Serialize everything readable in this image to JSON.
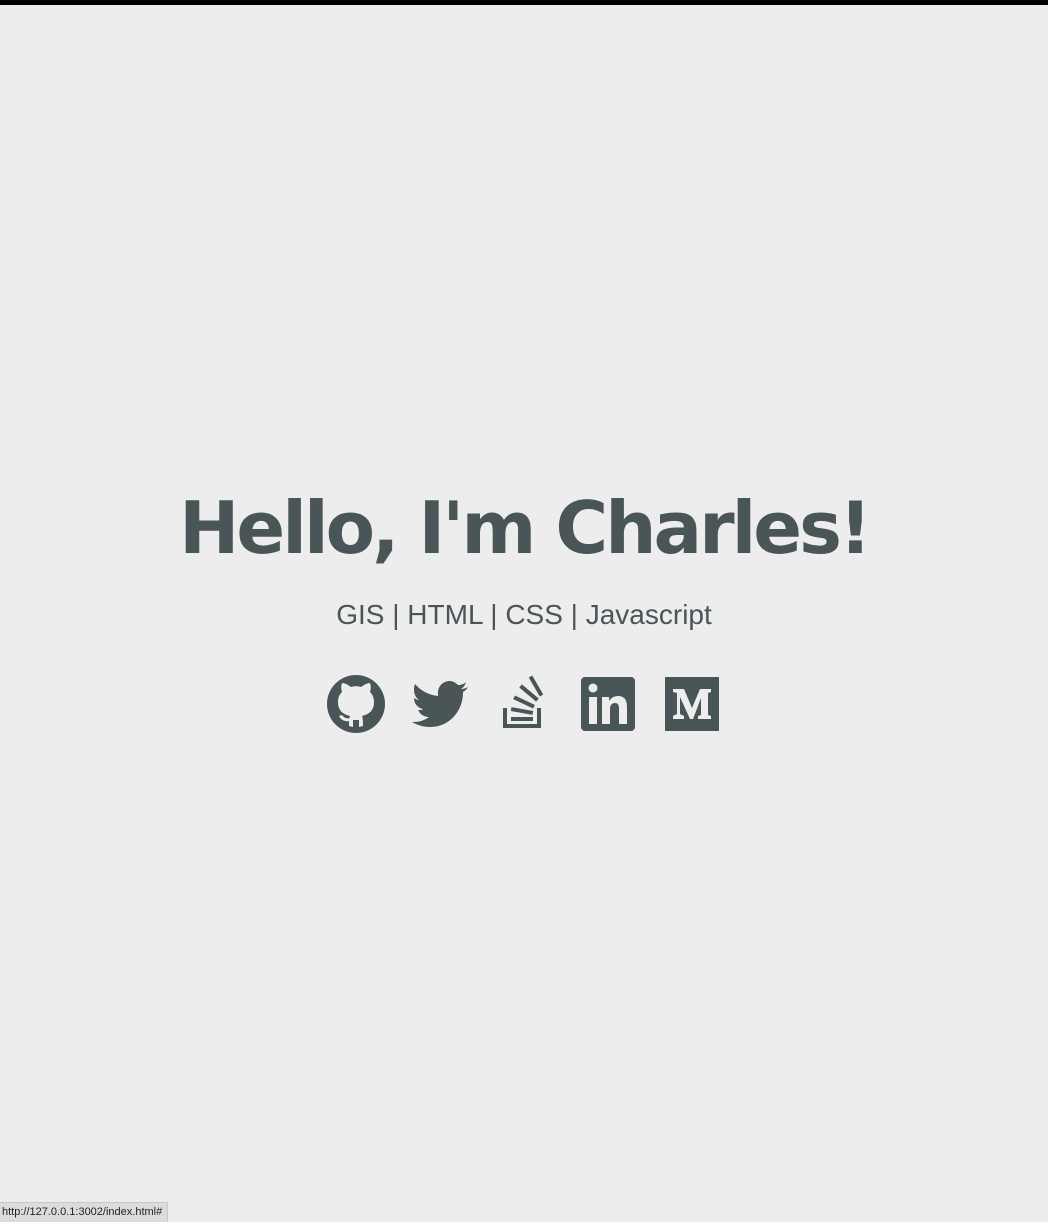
{
  "hero": {
    "title": "Hello, I'm Charles!",
    "subtitle": "GIS | HTML | CSS | Javascript"
  },
  "social_links": [
    {
      "name": "github",
      "icon": "github-icon"
    },
    {
      "name": "twitter",
      "icon": "twitter-icon"
    },
    {
      "name": "stackoverflow",
      "icon": "stackoverflow-icon"
    },
    {
      "name": "linkedin",
      "icon": "linkedin-icon"
    },
    {
      "name": "medium",
      "icon": "medium-icon"
    }
  ],
  "status_bar": {
    "url": "http://127.0.0.1:3002/index.html#"
  },
  "colors": {
    "background": "#ededed",
    "text": "#4a5558",
    "top_bar": "#000000"
  }
}
